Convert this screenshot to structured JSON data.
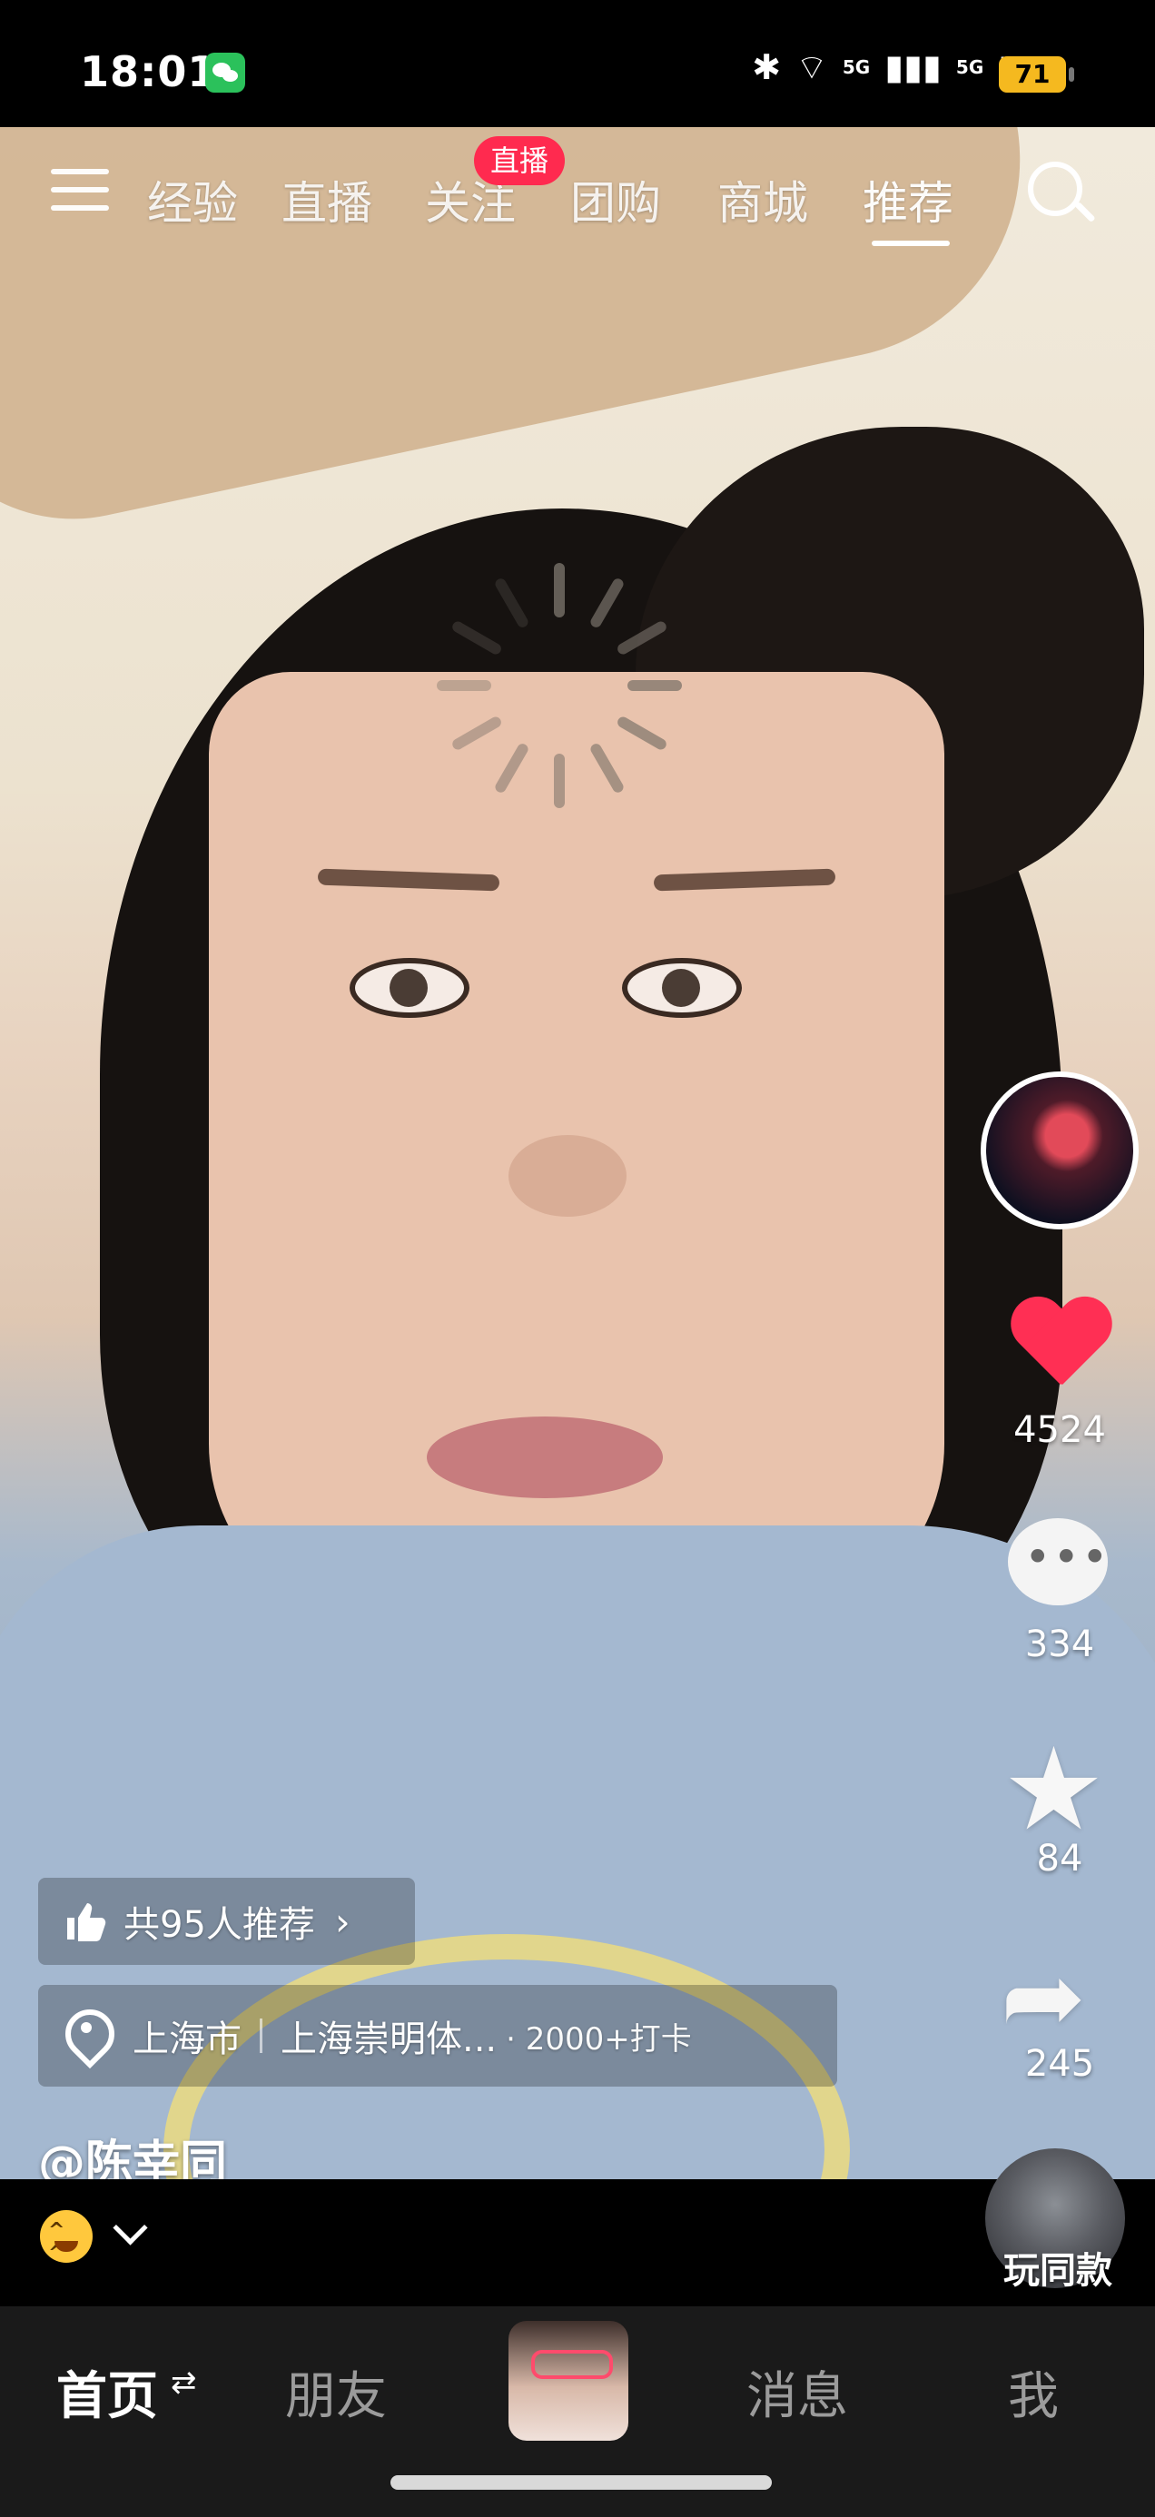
{
  "status_bar": {
    "time": "18:01",
    "signal1_label": "5G",
    "signal2_label": "5G",
    "battery_level": "71"
  },
  "top_nav": {
    "tabs": [
      {
        "label": "经验",
        "active": false
      },
      {
        "label": "直播",
        "active": false
      },
      {
        "label": "关注",
        "active": false
      },
      {
        "label": "团购",
        "active": false
      },
      {
        "label": "商城",
        "active": false
      },
      {
        "label": "推荐",
        "active": true
      }
    ],
    "live_badge": "直播"
  },
  "side_actions": {
    "likes": "4524",
    "comments": "334",
    "favorites": "84",
    "shares": "245"
  },
  "overlay": {
    "recommend_label": "共95人推荐",
    "location_city": "上海市",
    "location_place": "上海崇明体...",
    "location_checkins": "· 2000+打卡",
    "username": "@陈幸同"
  },
  "bottom_actions": {
    "same_style_label": "玩同款"
  },
  "bottom_nav": {
    "home_label": "首页",
    "friends_label": "朋友",
    "messages_label": "消息",
    "me_label": "我"
  },
  "colors": {
    "accent_red": "#ff2f54",
    "battery_yellow": "#f5b91f",
    "wechat_green": "#2bc15b"
  }
}
